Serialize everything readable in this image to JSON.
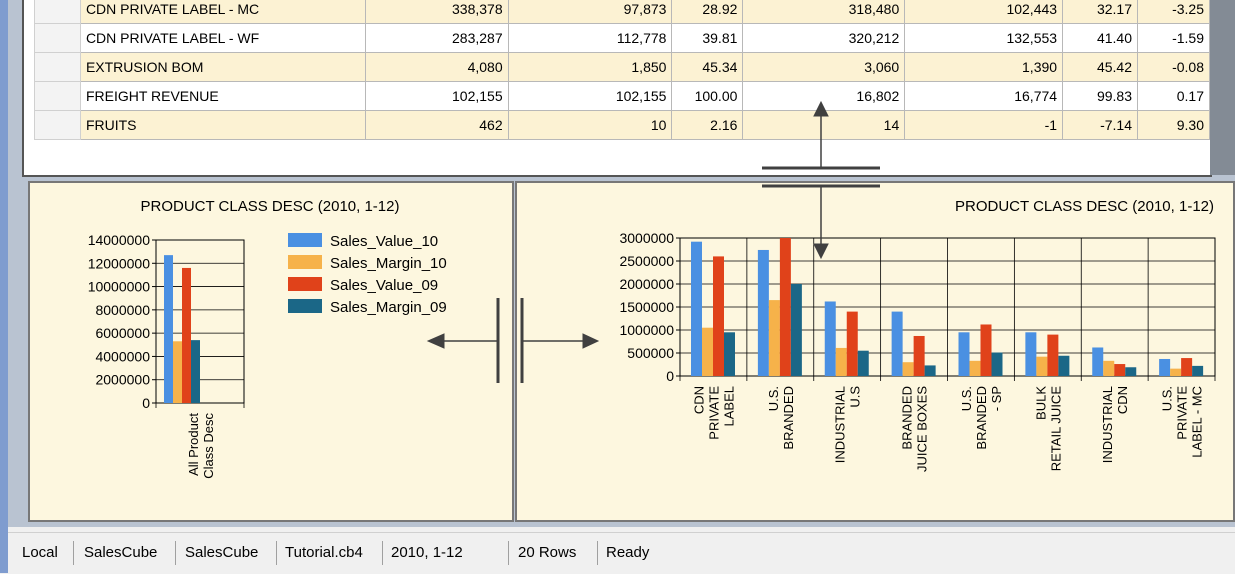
{
  "grid": {
    "rows": [
      {
        "name": "CDN PRIVATE LABEL - MC",
        "v1": "338,378",
        "v2": "97,873",
        "v3": "28.92",
        "v4": "318,480",
        "v5": "102,443",
        "v6": "32.17",
        "v7": "-3.25"
      },
      {
        "name": "CDN PRIVATE LABEL - WF",
        "v1": "283,287",
        "v2": "112,778",
        "v3": "39.81",
        "v4": "320,212",
        "v5": "132,553",
        "v6": "41.40",
        "v7": "-1.59"
      },
      {
        "name": "EXTRUSION BOM",
        "v1": "4,080",
        "v2": "1,850",
        "v3": "45.34",
        "v4": "3,060",
        "v5": "1,390",
        "v6": "45.42",
        "v7": "-0.08"
      },
      {
        "name": "FREIGHT REVENUE",
        "v1": "102,155",
        "v2": "102,155",
        "v3": "100.00",
        "v4": "16,802",
        "v5": "16,774",
        "v6": "99.83",
        "v7": "0.17"
      },
      {
        "name": "FRUITS",
        "v1": "462",
        "v2": "10",
        "v3": "2.16",
        "v4": "14",
        "v5": "-1",
        "v6": "-7.14",
        "v7": "9.30"
      }
    ]
  },
  "colors": {
    "s1": "#4a90e2",
    "s2": "#f6b24a",
    "s3": "#e0421a",
    "s4": "#1b6787",
    "panel": "#fdf7df"
  },
  "chart_data": [
    {
      "type": "bar",
      "title": "PRODUCT CLASS DESC (2010, 1-12)",
      "categories": [
        "All Product Class Desc"
      ],
      "series": [
        {
          "name": "Sales_Value_10",
          "values": [
            12700000
          ]
        },
        {
          "name": "Sales_Margin_10",
          "values": [
            5300000
          ]
        },
        {
          "name": "Sales_Value_09",
          "values": [
            11600000
          ]
        },
        {
          "name": "Sales_Margin_09",
          "values": [
            5400000
          ]
        }
      ],
      "ylim": [
        0,
        14000000
      ],
      "yticks": [
        "14000000",
        "12000000",
        "10000000",
        "8000000",
        "6000000",
        "4000000",
        "2000000",
        "0"
      ],
      "legend": "right"
    },
    {
      "type": "bar",
      "title": "PRODUCT CLASS DESC (2010, 1-12)",
      "categories": [
        [
          "CDN",
          "PRIVATE",
          "LABEL"
        ],
        [
          "U.S.",
          "BRANDED"
        ],
        [
          "INDUSTRIAL",
          "U.S"
        ],
        [
          "BRANDED",
          "JUICE BOXES"
        ],
        [
          "U.S.",
          "BRANDED",
          "- SP"
        ],
        [
          "BULK",
          "RETAIL JUICE"
        ],
        [
          "INDUSTRIAL",
          "CDN"
        ],
        [
          "U.S.",
          "PRIVATE",
          "LABEL - MC"
        ]
      ],
      "series": [
        {
          "name": "Sales_Value_10",
          "values": [
            2920000,
            2740000,
            1620000,
            1400000,
            950000,
            950000,
            620000,
            370000
          ]
        },
        {
          "name": "Sales_Margin_10",
          "values": [
            1050000,
            1650000,
            610000,
            300000,
            330000,
            420000,
            330000,
            160000
          ]
        },
        {
          "name": "Sales_Value_09",
          "values": [
            2600000,
            3000000,
            1400000,
            870000,
            1120000,
            900000,
            260000,
            390000
          ]
        },
        {
          "name": "Sales_Margin_09",
          "values": [
            950000,
            2000000,
            550000,
            230000,
            510000,
            440000,
            190000,
            220000
          ]
        }
      ],
      "ylim": [
        0,
        3000000
      ],
      "yticks": [
        "3000000",
        "2500000",
        "2000000",
        "1500000",
        "1000000",
        "500000",
        "0"
      ],
      "legend": "none"
    }
  ],
  "status": [
    "Local",
    "SalesCube",
    "SalesCube",
    "Tutorial.cb4",
    "2010, 1-12",
    "20 Rows",
    "Ready"
  ]
}
